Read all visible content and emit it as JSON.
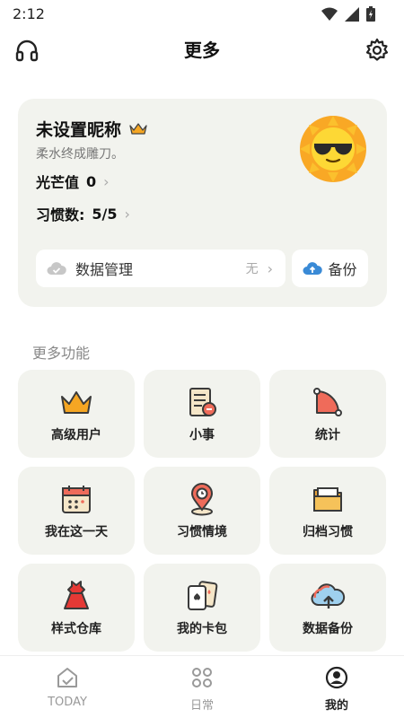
{
  "status_bar": {
    "time": "2:12"
  },
  "header": {
    "title": "更多"
  },
  "profile": {
    "nickname": "未设置昵称",
    "motto": "柔水终成雕刀。",
    "glow_label": "光芒值",
    "glow_value": "0",
    "habits_label": "习惯数:",
    "habits_value": "5/5"
  },
  "data_management": {
    "label": "数据管理",
    "value": "无"
  },
  "backup": {
    "label": "备份"
  },
  "more_features": {
    "title": "更多功能",
    "items": [
      {
        "label": "高级用户",
        "icon": "crown-icon"
      },
      {
        "label": "小事",
        "icon": "checklist-icon"
      },
      {
        "label": "统计",
        "icon": "statistics-icon"
      },
      {
        "label": "我在这一天",
        "icon": "calendar-icon"
      },
      {
        "label": "习惯情境",
        "icon": "location-pin-icon"
      },
      {
        "label": "归档习惯",
        "icon": "folder-icon"
      },
      {
        "label": "样式仓库",
        "icon": "dress-icon"
      },
      {
        "label": "我的卡包",
        "icon": "cards-icon"
      },
      {
        "label": "数据备份",
        "icon": "cloud-backup-icon"
      }
    ]
  },
  "bottom_nav": {
    "items": [
      {
        "label": "TODAY",
        "icon": "today-icon",
        "active": false
      },
      {
        "label": "日常",
        "icon": "grid-icon",
        "active": false
      },
      {
        "label": "我的",
        "icon": "profile-icon",
        "active": true
      }
    ]
  },
  "colors": {
    "card_bg": "#f2f3ee",
    "accent_blue": "#3a8ad6",
    "crown_orange": "#f5a623",
    "stat_red": "#ef6b5a"
  }
}
